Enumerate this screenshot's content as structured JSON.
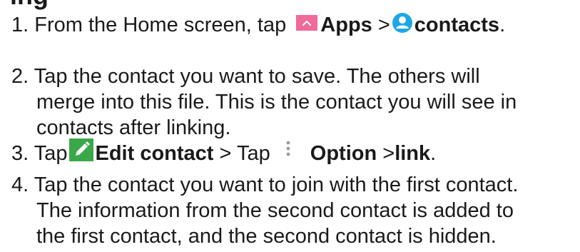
{
  "heading_clip": {
    "visible_fragment": "ing"
  },
  "steps": [
    {
      "num": "1.",
      "text_before": "From the Home screen, tap",
      "apps_label": "Apps",
      "sep": ">",
      "contacts_label": "contacts",
      "end": "."
    },
    {
      "num": "2.",
      "lines": [
        "Tap the contact you want to save. The others will",
        "merge into this file. This is the contact you will see in",
        "contacts after linking."
      ]
    },
    {
      "num": "3.",
      "tap1": "Tap",
      "edit_label": "Edit contact",
      "sep1": "> Tap",
      "option_label": "Option",
      "sep2": ">",
      "link_label": "link",
      "end": "."
    },
    {
      "num": "4.",
      "lines": [
        "Tap the contact you want to join with the first contact.",
        "The information from the second contact is added to",
        "the first contact, and the second contact is hidden."
      ]
    }
  ],
  "icons": {
    "apps": "apps-chevron-up-icon",
    "contacts": "contacts-person-icon",
    "edit": "pencil-edit-icon",
    "option": "more-vertical-icon"
  },
  "colors": {
    "apps_bg": "#f06a9a",
    "contacts_blue": "#1ea7e6",
    "edit_green": "#3aa84a",
    "option_gray": "#9a9a9a",
    "text": "#1a1a1a"
  }
}
